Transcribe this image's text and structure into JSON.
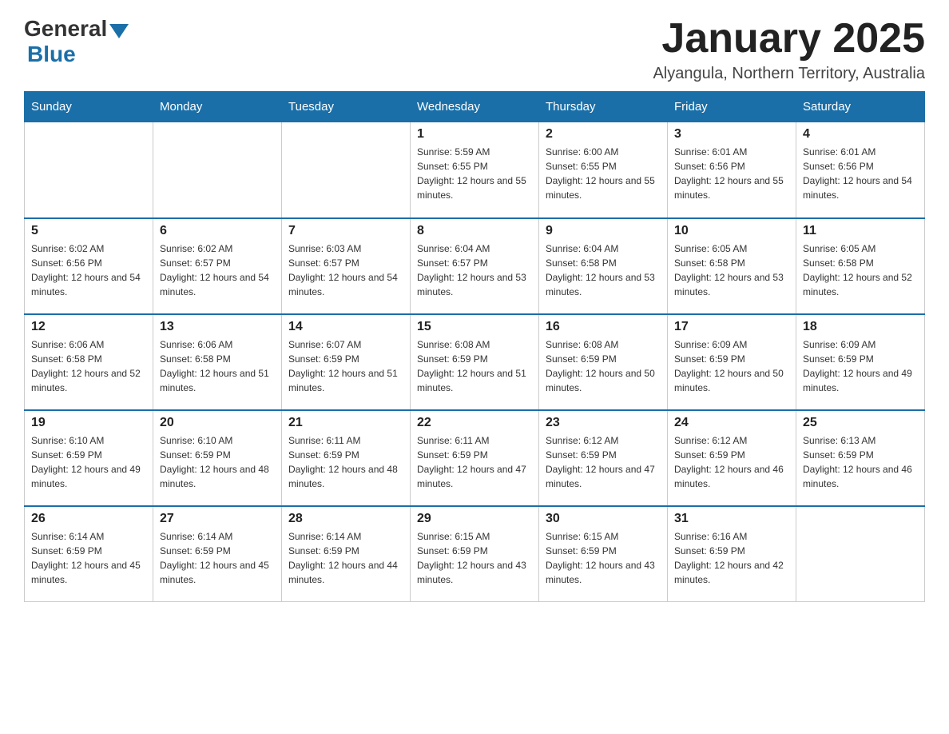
{
  "header": {
    "logo_general": "General",
    "logo_blue": "Blue",
    "title": "January 2025",
    "subtitle": "Alyangula, Northern Territory, Australia"
  },
  "calendar": {
    "days_of_week": [
      "Sunday",
      "Monday",
      "Tuesday",
      "Wednesday",
      "Thursday",
      "Friday",
      "Saturday"
    ],
    "weeks": [
      [
        {
          "day": "",
          "info": ""
        },
        {
          "day": "",
          "info": ""
        },
        {
          "day": "",
          "info": ""
        },
        {
          "day": "1",
          "info": "Sunrise: 5:59 AM\nSunset: 6:55 PM\nDaylight: 12 hours and 55 minutes."
        },
        {
          "day": "2",
          "info": "Sunrise: 6:00 AM\nSunset: 6:55 PM\nDaylight: 12 hours and 55 minutes."
        },
        {
          "day": "3",
          "info": "Sunrise: 6:01 AM\nSunset: 6:56 PM\nDaylight: 12 hours and 55 minutes."
        },
        {
          "day": "4",
          "info": "Sunrise: 6:01 AM\nSunset: 6:56 PM\nDaylight: 12 hours and 54 minutes."
        }
      ],
      [
        {
          "day": "5",
          "info": "Sunrise: 6:02 AM\nSunset: 6:56 PM\nDaylight: 12 hours and 54 minutes."
        },
        {
          "day": "6",
          "info": "Sunrise: 6:02 AM\nSunset: 6:57 PM\nDaylight: 12 hours and 54 minutes."
        },
        {
          "day": "7",
          "info": "Sunrise: 6:03 AM\nSunset: 6:57 PM\nDaylight: 12 hours and 54 minutes."
        },
        {
          "day": "8",
          "info": "Sunrise: 6:04 AM\nSunset: 6:57 PM\nDaylight: 12 hours and 53 minutes."
        },
        {
          "day": "9",
          "info": "Sunrise: 6:04 AM\nSunset: 6:58 PM\nDaylight: 12 hours and 53 minutes."
        },
        {
          "day": "10",
          "info": "Sunrise: 6:05 AM\nSunset: 6:58 PM\nDaylight: 12 hours and 53 minutes."
        },
        {
          "day": "11",
          "info": "Sunrise: 6:05 AM\nSunset: 6:58 PM\nDaylight: 12 hours and 52 minutes."
        }
      ],
      [
        {
          "day": "12",
          "info": "Sunrise: 6:06 AM\nSunset: 6:58 PM\nDaylight: 12 hours and 52 minutes."
        },
        {
          "day": "13",
          "info": "Sunrise: 6:06 AM\nSunset: 6:58 PM\nDaylight: 12 hours and 51 minutes."
        },
        {
          "day": "14",
          "info": "Sunrise: 6:07 AM\nSunset: 6:59 PM\nDaylight: 12 hours and 51 minutes."
        },
        {
          "day": "15",
          "info": "Sunrise: 6:08 AM\nSunset: 6:59 PM\nDaylight: 12 hours and 51 minutes."
        },
        {
          "day": "16",
          "info": "Sunrise: 6:08 AM\nSunset: 6:59 PM\nDaylight: 12 hours and 50 minutes."
        },
        {
          "day": "17",
          "info": "Sunrise: 6:09 AM\nSunset: 6:59 PM\nDaylight: 12 hours and 50 minutes."
        },
        {
          "day": "18",
          "info": "Sunrise: 6:09 AM\nSunset: 6:59 PM\nDaylight: 12 hours and 49 minutes."
        }
      ],
      [
        {
          "day": "19",
          "info": "Sunrise: 6:10 AM\nSunset: 6:59 PM\nDaylight: 12 hours and 49 minutes."
        },
        {
          "day": "20",
          "info": "Sunrise: 6:10 AM\nSunset: 6:59 PM\nDaylight: 12 hours and 48 minutes."
        },
        {
          "day": "21",
          "info": "Sunrise: 6:11 AM\nSunset: 6:59 PM\nDaylight: 12 hours and 48 minutes."
        },
        {
          "day": "22",
          "info": "Sunrise: 6:11 AM\nSunset: 6:59 PM\nDaylight: 12 hours and 47 minutes."
        },
        {
          "day": "23",
          "info": "Sunrise: 6:12 AM\nSunset: 6:59 PM\nDaylight: 12 hours and 47 minutes."
        },
        {
          "day": "24",
          "info": "Sunrise: 6:12 AM\nSunset: 6:59 PM\nDaylight: 12 hours and 46 minutes."
        },
        {
          "day": "25",
          "info": "Sunrise: 6:13 AM\nSunset: 6:59 PM\nDaylight: 12 hours and 46 minutes."
        }
      ],
      [
        {
          "day": "26",
          "info": "Sunrise: 6:14 AM\nSunset: 6:59 PM\nDaylight: 12 hours and 45 minutes."
        },
        {
          "day": "27",
          "info": "Sunrise: 6:14 AM\nSunset: 6:59 PM\nDaylight: 12 hours and 45 minutes."
        },
        {
          "day": "28",
          "info": "Sunrise: 6:14 AM\nSunset: 6:59 PM\nDaylight: 12 hours and 44 minutes."
        },
        {
          "day": "29",
          "info": "Sunrise: 6:15 AM\nSunset: 6:59 PM\nDaylight: 12 hours and 43 minutes."
        },
        {
          "day": "30",
          "info": "Sunrise: 6:15 AM\nSunset: 6:59 PM\nDaylight: 12 hours and 43 minutes."
        },
        {
          "day": "31",
          "info": "Sunrise: 6:16 AM\nSunset: 6:59 PM\nDaylight: 12 hours and 42 minutes."
        },
        {
          "day": "",
          "info": ""
        }
      ]
    ]
  }
}
